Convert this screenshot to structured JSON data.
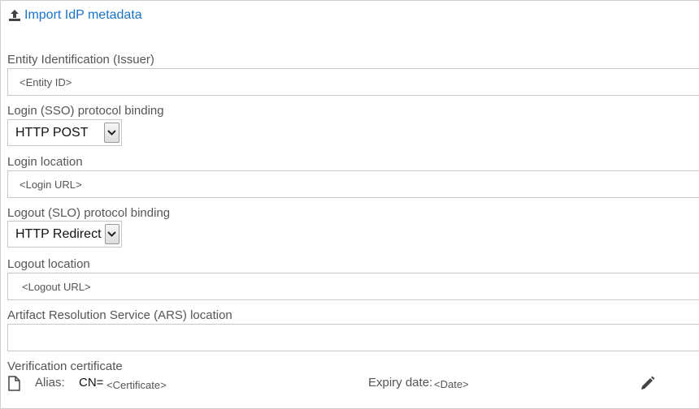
{
  "import": {
    "label": "Import IdP metadata",
    "icon": "upload-icon"
  },
  "entity": {
    "label": "Entity Identification (Issuer)",
    "placeholder": "<Entity ID>"
  },
  "sso_binding": {
    "label": "Login (SSO) protocol binding",
    "value": "HTTP POST"
  },
  "login_location": {
    "label": "Login location",
    "placeholder": "<Login URL>"
  },
  "slo_binding": {
    "label": "Logout (SLO) protocol binding",
    "value": "HTTP Redirect"
  },
  "logout_location": {
    "label": "Logout location",
    "placeholder": "<Logout URL>"
  },
  "ars_location": {
    "label": "Artifact Resolution Service (ARS) location",
    "placeholder": ""
  },
  "certificate": {
    "label": "Verification certificate",
    "alias_label": "Alias:",
    "cn_prefix": "CN=",
    "cn_value": "<Certificate>",
    "expiry_label": "Expiry date:",
    "expiry_value": "<Date>",
    "file_icon": "document-icon",
    "edit_icon": "pencil-icon"
  },
  "colors": {
    "link": "#1a73c9",
    "text": "#555555",
    "border": "#c8c8c8"
  }
}
